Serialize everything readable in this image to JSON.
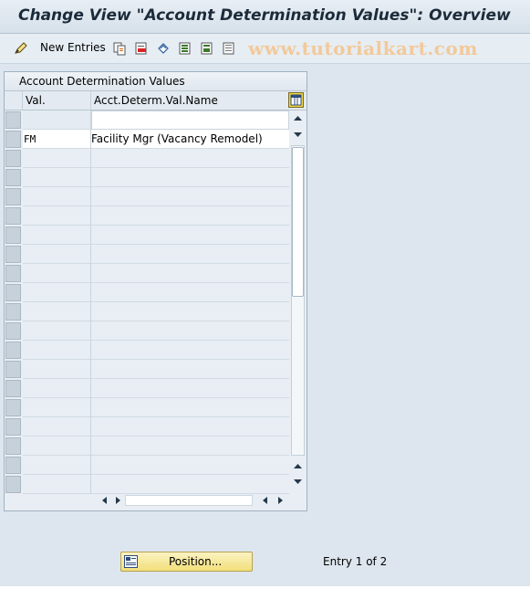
{
  "window": {
    "title": "Change View \"Account Determination Values\": Overview"
  },
  "toolbar": {
    "new_entries_label": "New Entries",
    "watermark": "www.tutorialkart.com"
  },
  "table": {
    "panel_title": "Account Determination Values",
    "columns": [
      "Val.",
      "Acct.Determ.Val.Name"
    ],
    "rows": [
      {
        "val": "",
        "name": ""
      },
      {
        "val": "FM",
        "name": "Facility Mgr (Vacancy Remodel)"
      }
    ]
  },
  "footer": {
    "position_label": "Position...",
    "entry_text": "Entry 1 of 2"
  },
  "colors": {
    "title_text": "#1c2b3a",
    "panel_bg": "#e8eef3",
    "button_yellow": "#f2df7a",
    "watermark": "#f3c99a"
  }
}
